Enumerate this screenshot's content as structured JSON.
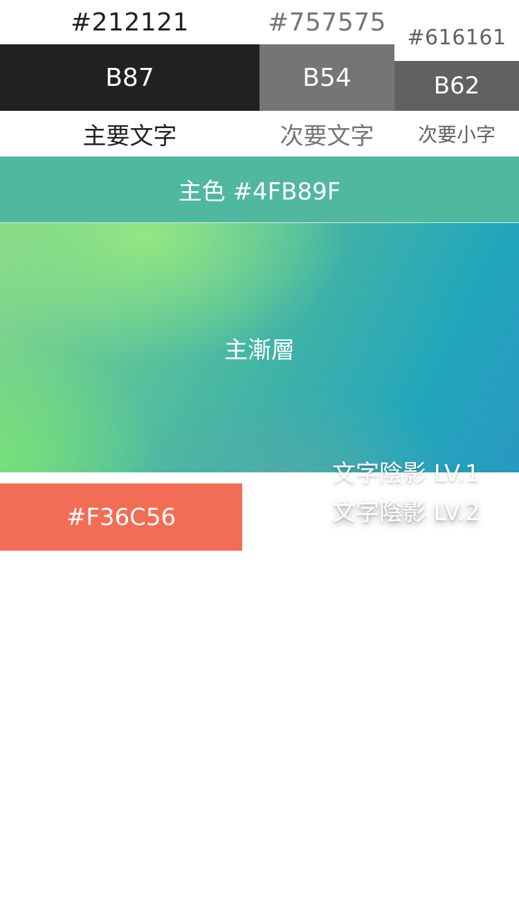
{
  "colors": {
    "primary_text": "#212121",
    "secondary_text": "#757575",
    "secondary_small": "#616161",
    "primary": "#4FB89F",
    "accent": "#F36C56"
  },
  "hex_labels": {
    "primary_text": "#212121",
    "secondary_text": "#757575",
    "secondary_small": "#616161"
  },
  "swatches": {
    "b87": "B87",
    "b54": "B54",
    "b62": "B62"
  },
  "text_samples": {
    "primary": "主要文字",
    "secondary": "次要文字",
    "small": "次要小字"
  },
  "primary_band": {
    "label": "主色 #4FB89F"
  },
  "gradient": {
    "label": "主漸層"
  },
  "shadows": {
    "lv1": "文字陰影 LV.1",
    "lv2": "文字陰影 LV.2"
  },
  "accent_swatch": {
    "label": "#F36C56"
  }
}
